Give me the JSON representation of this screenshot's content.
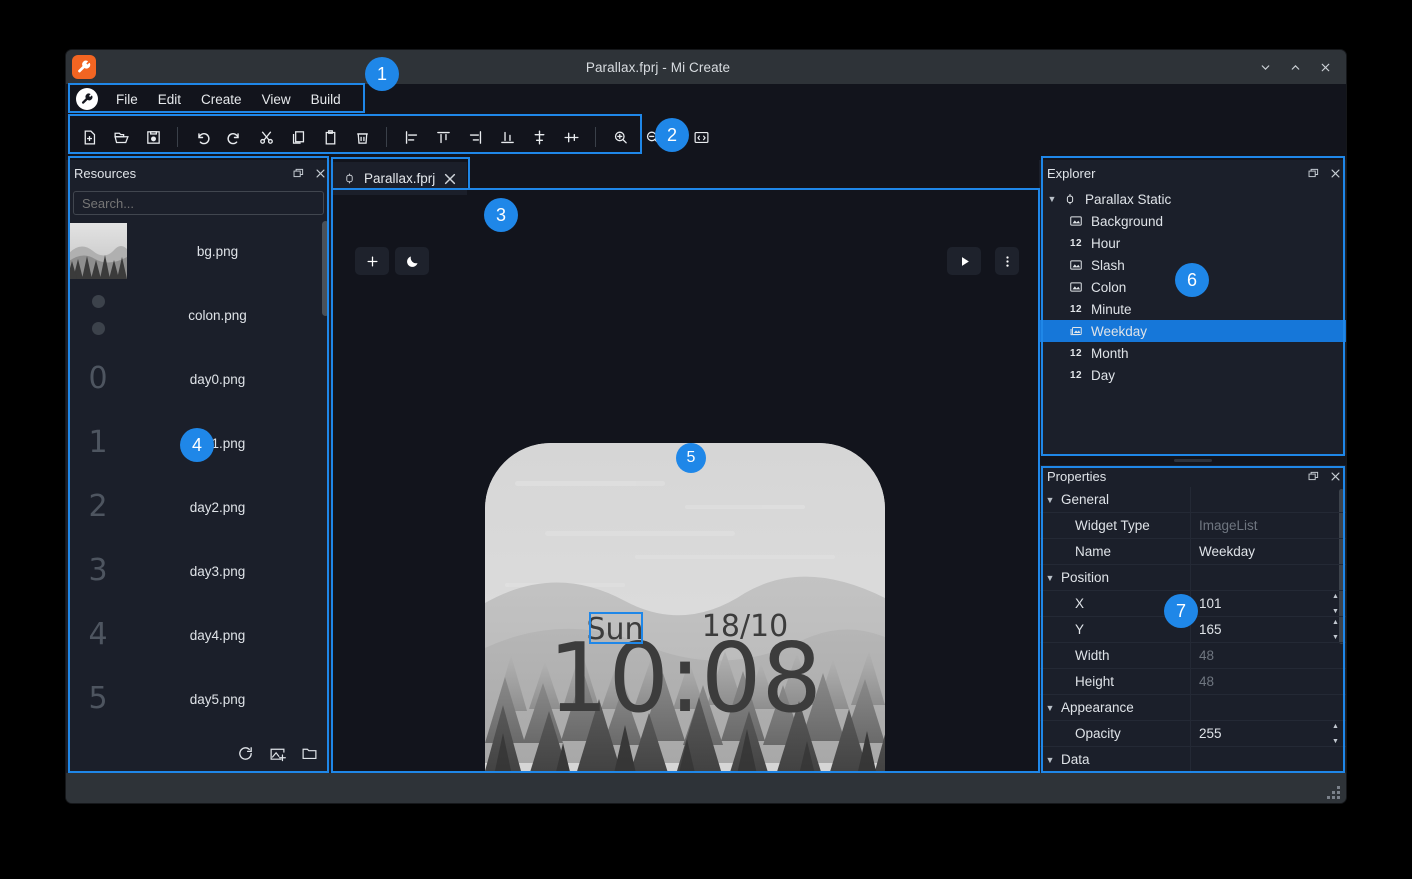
{
  "window": {
    "title": "Parallax.fprj - Mi Create",
    "logo_icon": "wrench-icon",
    "minimize_icon": "chevron-down-icon",
    "maximize_icon": "chevron-up-icon",
    "close_icon": "close-icon"
  },
  "menubar": {
    "logo_icon": "wrench-icon",
    "items": [
      {
        "label": "File"
      },
      {
        "label": "Edit"
      },
      {
        "label": "Create"
      },
      {
        "label": "View"
      },
      {
        "label": "Build"
      }
    ]
  },
  "toolbar": {
    "groups": [
      [
        {
          "name": "new-file-icon",
          "title": "New"
        },
        {
          "name": "open-folder-icon",
          "title": "Open"
        },
        {
          "name": "save-icon",
          "title": "Save"
        }
      ],
      [
        {
          "name": "undo-icon",
          "title": "Undo"
        },
        {
          "name": "redo-icon",
          "title": "Redo"
        },
        {
          "name": "cut-icon",
          "title": "Cut"
        },
        {
          "name": "copy-icon",
          "title": "Copy"
        },
        {
          "name": "paste-icon",
          "title": "Paste"
        },
        {
          "name": "delete-icon",
          "title": "Delete"
        }
      ],
      [
        {
          "name": "align-left-icon",
          "title": "Align left"
        },
        {
          "name": "align-top-icon",
          "title": "Align top"
        },
        {
          "name": "align-right-icon",
          "title": "Align right"
        },
        {
          "name": "align-bottom-icon",
          "title": "Align bottom"
        },
        {
          "name": "align-center-horizontal-icon",
          "title": "Center horizontally"
        },
        {
          "name": "align-center-vertical-icon",
          "title": "Center vertically"
        }
      ],
      [
        {
          "name": "zoom-in-icon",
          "title": "Zoom in"
        },
        {
          "name": "zoom-out-icon",
          "title": "Zoom out"
        }
      ],
      [
        {
          "name": "code-view-icon",
          "title": "Code view"
        }
      ]
    ]
  },
  "resources": {
    "title": "Resources",
    "float_icon": "float-panel-icon",
    "close_icon": "close-icon",
    "search": {
      "placeholder": "Search...",
      "value": ""
    },
    "items": [
      {
        "name": "bg.png",
        "thumb": "landscape"
      },
      {
        "name": "colon.png",
        "thumb": "colon"
      },
      {
        "name": "day0.png",
        "thumb": "digit",
        "digit": "0"
      },
      {
        "name": "day1.png",
        "thumb": "digit",
        "digit": "1"
      },
      {
        "name": "day2.png",
        "thumb": "digit",
        "digit": "2"
      },
      {
        "name": "day3.png",
        "thumb": "digit",
        "digit": "3"
      },
      {
        "name": "day4.png",
        "thumb": "digit",
        "digit": "4"
      },
      {
        "name": "day5.png",
        "thumb": "digit",
        "digit": "5"
      }
    ],
    "footer": [
      {
        "name": "refresh-icon"
      },
      {
        "name": "add-image-icon"
      },
      {
        "name": "open-folder-icon"
      }
    ]
  },
  "editor": {
    "tab": {
      "label": "Parallax.fprj",
      "icon": "watch-icon",
      "close_icon": "close-icon"
    },
    "canvas_buttons_left": [
      {
        "name": "add-widget-button",
        "icon": "plus-icon"
      },
      {
        "name": "night-mode-button",
        "icon": "moon-icon"
      }
    ],
    "canvas_buttons_right": [
      {
        "name": "play-preview-button",
        "icon": "play-icon"
      },
      {
        "name": "more-options-button",
        "icon": "vertical-dots-icon"
      }
    ],
    "watchface": {
      "weekday": "Sun",
      "date": "18/10",
      "time": "10:08",
      "selected_widget": "Sun"
    }
  },
  "explorer": {
    "title": "Explorer",
    "float_icon": "float-panel-icon",
    "close_icon": "close-icon",
    "root": {
      "label": "Parallax Static",
      "icon": "watch-icon",
      "caret": "▼"
    },
    "nodes": [
      {
        "label": "Background",
        "icon": "image-icon",
        "selected": false
      },
      {
        "label": "Hour",
        "icon": "number-icon",
        "selected": false
      },
      {
        "label": "Slash",
        "icon": "image-icon",
        "selected": false
      },
      {
        "label": "Colon",
        "icon": "image-icon",
        "selected": false
      },
      {
        "label": "Minute",
        "icon": "number-icon",
        "selected": false
      },
      {
        "label": "Weekday",
        "icon": "imagelist-icon",
        "selected": true
      },
      {
        "label": "Month",
        "icon": "number-icon",
        "selected": false
      },
      {
        "label": "Day",
        "icon": "number-icon",
        "selected": false
      }
    ],
    "number_icon_text": "12"
  },
  "properties": {
    "title": "Properties",
    "float_icon": "float-panel-icon",
    "close_icon": "close-icon",
    "rows": [
      {
        "kind": "group",
        "name": "General",
        "caret": "▼"
      },
      {
        "kind": "prop",
        "name": "Widget Type",
        "value": "ImageList",
        "readonly": true,
        "spinner": false
      },
      {
        "kind": "prop",
        "name": "Name",
        "value": "Weekday",
        "readonly": false,
        "spinner": false
      },
      {
        "kind": "group",
        "name": "Position",
        "caret": "▼"
      },
      {
        "kind": "prop",
        "name": "X",
        "value": "101",
        "readonly": false,
        "spinner": true
      },
      {
        "kind": "prop",
        "name": "Y",
        "value": "165",
        "readonly": false,
        "spinner": true
      },
      {
        "kind": "prop",
        "name": "Width",
        "value": "48",
        "readonly": true,
        "spinner": false
      },
      {
        "kind": "prop",
        "name": "Height",
        "value": "48",
        "readonly": true,
        "spinner": false
      },
      {
        "kind": "group",
        "name": "Appearance",
        "caret": "▼"
      },
      {
        "kind": "prop",
        "name": "Opacity",
        "value": "255",
        "readonly": false,
        "spinner": true
      },
      {
        "kind": "group",
        "name": "Data",
        "caret": "▼"
      }
    ]
  },
  "annotations": {
    "accent": "#1f87e8",
    "badges": [
      {
        "id": "1",
        "target": "menubar"
      },
      {
        "id": "2",
        "target": "toolbar"
      },
      {
        "id": "3",
        "target": "editor-tab"
      },
      {
        "id": "4",
        "target": "resources-panel"
      },
      {
        "id": "5",
        "target": "watchface-canvas"
      },
      {
        "id": "6",
        "target": "explorer-panel"
      },
      {
        "id": "7",
        "target": "properties-panel"
      }
    ]
  },
  "statusbar": {
    "resize_grip_icon": "resize-grip-icon"
  }
}
